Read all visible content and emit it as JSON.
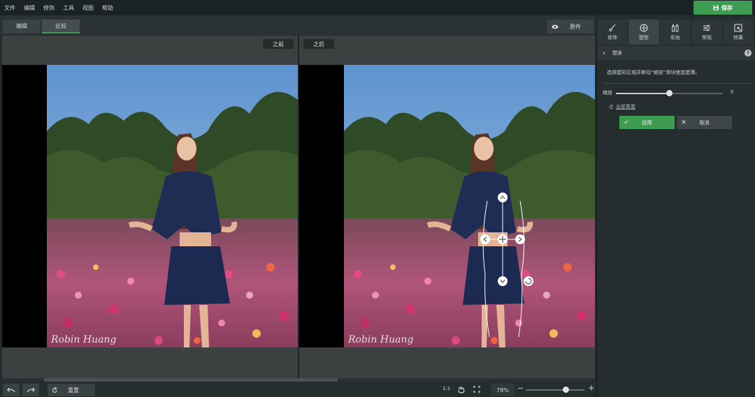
{
  "menu": [
    "文件",
    "编辑",
    "修饰",
    "工具",
    "视图",
    "帮助"
  ],
  "save_label": "保存",
  "tabs": {
    "edit": "编辑",
    "compare": "比较"
  },
  "original_label": "原件",
  "before_label": "之前",
  "after_label": "之后",
  "watermark": "Robin Huang",
  "bottom": {
    "reset_label": "重置",
    "ratio": "1:1",
    "zoom": "78%"
  },
  "panel": {
    "tabs": [
      "修饰",
      "塑型",
      "彩妆",
      "常规",
      "效果"
    ],
    "section_title": "塑身",
    "hint": "选择塑形区域并移动“缩放”滑块使其塑薄。",
    "slider_label": "缩放",
    "slider_value": "0",
    "reset_all": "全部重置",
    "apply": "应用",
    "cancel": "取消"
  },
  "colors": {
    "accent": "#3e9b52"
  }
}
